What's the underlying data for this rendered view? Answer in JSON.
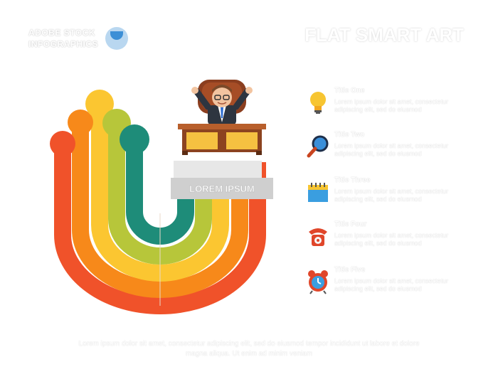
{
  "header": {
    "logo_line1": "ADOBE STOCK",
    "logo_line2": "INFOGRAPHICS",
    "logo_icon": "shield-icon",
    "title": "FLAT SMART ART"
  },
  "banner": {
    "label": "LOREM IPSUM"
  },
  "colors": {
    "red": "#f0522a",
    "orange": "#f7891a",
    "yellow": "#fbc631",
    "lime": "#b7c63a",
    "teal": "#1e8c79",
    "desk": "#b85f2c",
    "banner_grey": "#cfcfcf"
  },
  "items": [
    {
      "icon": "lightbulb-icon",
      "title": "Title One",
      "desc": "Lorem ipsum dolor sit amet, consectetur adipiscing elit, sed do eiusmod"
    },
    {
      "icon": "magnifier-icon",
      "title": "Title Two",
      "desc": "Lorem ipsum dolor sit amet, consectetur adipiscing elit, sed do eiusmod"
    },
    {
      "icon": "notepad-icon",
      "title": "Title Three",
      "desc": "Lorem ipsum dolor sit amet, consectetur adipiscing elit, sed do eiusmod"
    },
    {
      "icon": "telephone-icon",
      "title": "Title Four",
      "desc": "Lorem ipsum dolor sit amet, consectetur adipiscing elit, sed do eiusmod"
    },
    {
      "icon": "alarm-clock-icon",
      "title": "Title Five",
      "desc": "Lorem ipsum dolor sit amet, consectetur adipiscing elit, sed do eiusmod"
    }
  ],
  "footer": {
    "text": "Lorem ipsum dolor sit amet, consectetur adipiscing elit, sed do eiusmod tempor incididunt ut labore et dolore magna aliqua. Ut enim ad minim veniam"
  }
}
